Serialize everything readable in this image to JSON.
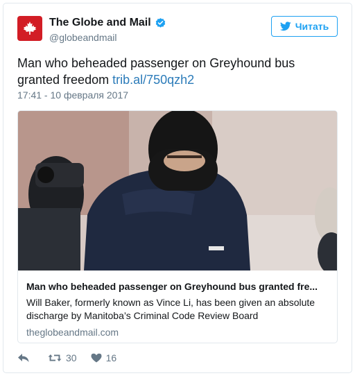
{
  "account": {
    "display_name": "The Globe and Mail",
    "handle": "@globeandmail",
    "verified": true,
    "avatar_color": "#d21d25"
  },
  "follow_button": {
    "label": "Читать",
    "icon": "twitter-bird-icon",
    "color": "#1da1f2"
  },
  "tweet": {
    "text": "Man who beheaded passenger on Greyhound bus granted freedom",
    "link": "trib.al/750qzh2",
    "timestamp": "17:41 - 10 февраля 2017"
  },
  "card": {
    "title": "Man who beheaded passenger on Greyhound bus granted fre...",
    "description": "Will Baker, formerly known as Vince Li, has been given an absolute discharge by Manitoba’s Criminal Code Review Board",
    "domain": "theglobeandmail.com",
    "image": "photo-man-in-black-balaclava-and-navy-parka"
  },
  "actions": {
    "reply_icon": "reply-icon",
    "retweet_icon": "retweet-icon",
    "retweet_count": "30",
    "like_icon": "heart-icon",
    "like_count": "16"
  }
}
